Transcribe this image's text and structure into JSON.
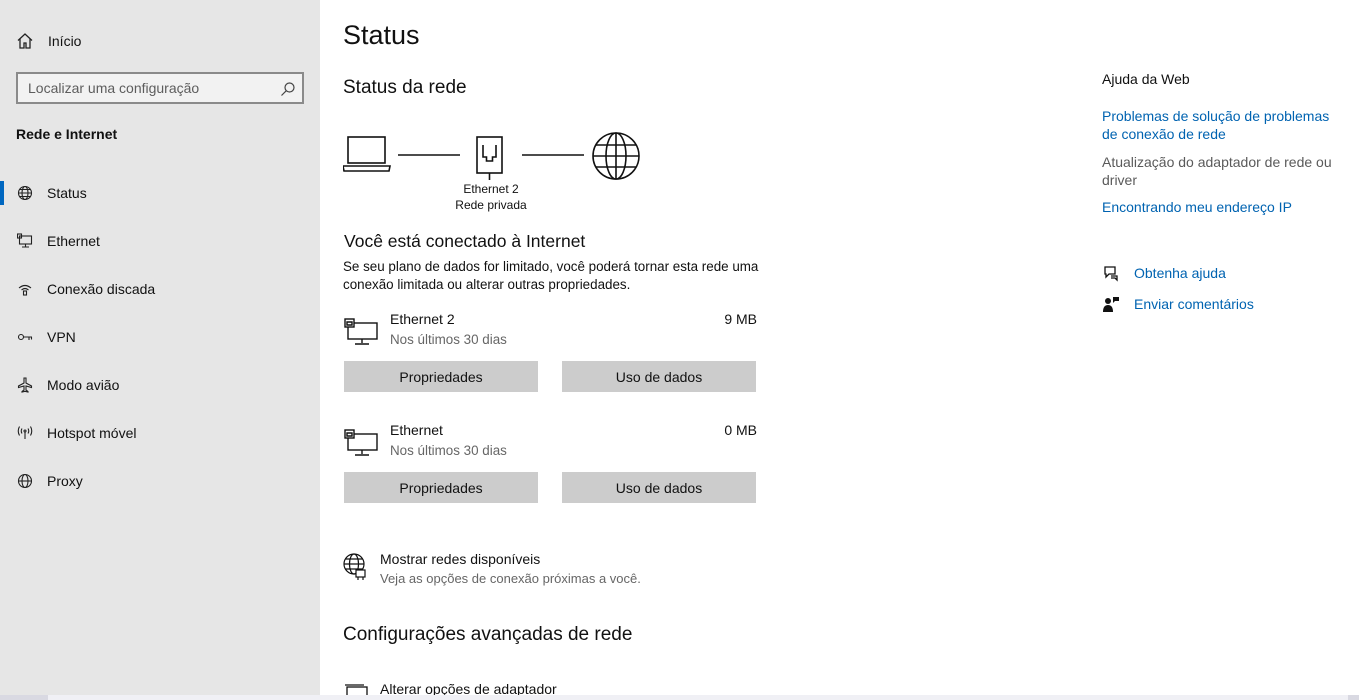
{
  "sidebar": {
    "home_label": "Início",
    "search_placeholder": "Localizar uma configuração",
    "section_title": "Rede e Internet",
    "items": [
      {
        "label": "Status",
        "icon": "globe-network-icon",
        "active": true
      },
      {
        "label": "Ethernet",
        "icon": "ethernet-icon"
      },
      {
        "label": "Conexão discada",
        "icon": "dialup-icon"
      },
      {
        "label": "VPN",
        "icon": "vpn-icon"
      },
      {
        "label": "Modo avião",
        "icon": "airplane-icon"
      },
      {
        "label": "Hotspot móvel",
        "icon": "hotspot-icon"
      },
      {
        "label": "Proxy",
        "icon": "globe-icon"
      }
    ]
  },
  "main": {
    "title": "Status",
    "network_status_heading": "Status da rede",
    "diagram": {
      "adapter_name": "Ethernet 2",
      "network_type": "Rede privada"
    },
    "connected_heading": "Você está conectado à Internet",
    "connected_text": "Se seu plano de dados for limitado, você poderá tornar esta rede uma conexão limitada ou alterar outras propriedades.",
    "adapters": [
      {
        "name": "Ethernet 2",
        "period": "Nos últimos 30 dias",
        "usage": "9 MB",
        "properties_label": "Propriedades",
        "data_usage_label": "Uso de dados"
      },
      {
        "name": "Ethernet",
        "period": "Nos últimos 30 dias",
        "usage": "0 MB",
        "properties_label": "Propriedades",
        "data_usage_label": "Uso de dados"
      }
    ],
    "show_networks": {
      "title": "Mostrar redes disponíveis",
      "subtitle": "Veja as opções de conexão próximas a você."
    },
    "advanced_heading": "Configurações avançadas de rede",
    "change_adapter_label": "Alterar opções de adaptador"
  },
  "right_panel": {
    "web_help_title": "Ajuda da Web",
    "link_troubleshoot": "Problemas de solução de problemas de conexão de rede",
    "gray_item": "Atualização do adaptador de rede ou driver",
    "link_find_ip": "Encontrando meu endereço IP",
    "get_help": "Obtenha ajuda",
    "send_feedback": "Enviar comentários"
  },
  "colors": {
    "accent": "#0067c0",
    "link": "#0063b1",
    "sidebar_bg": "#e6e6e6",
    "button_bg": "#cccccc"
  }
}
